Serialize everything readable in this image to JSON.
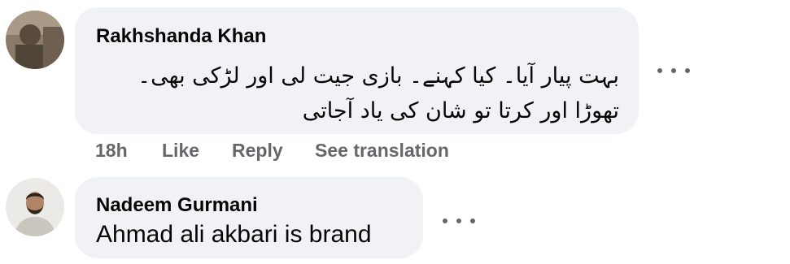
{
  "comments": [
    {
      "author": "Rakhshanda Khan",
      "text_lines": [
        "بہت پیار آیا۔ کیا کہنے۔ بازی جیت لی اور لڑکی بھی۔",
        "تھوڑا اور کرتا تو شان کی یاد آجاتی"
      ],
      "timestamp": "18h",
      "like_label": "Like",
      "reply_label": "Reply",
      "translate_label": "See translation",
      "more_icon": "more-horizontal-icon"
    },
    {
      "author": "Nadeem Gurmani",
      "text": "Ahmad ali akbari is brand",
      "more_icon": "more-horizontal-icon"
    }
  ],
  "colors": {
    "bubble_bg": "#f0f2f5",
    "text_primary": "#050505",
    "text_secondary": "#65676b"
  }
}
